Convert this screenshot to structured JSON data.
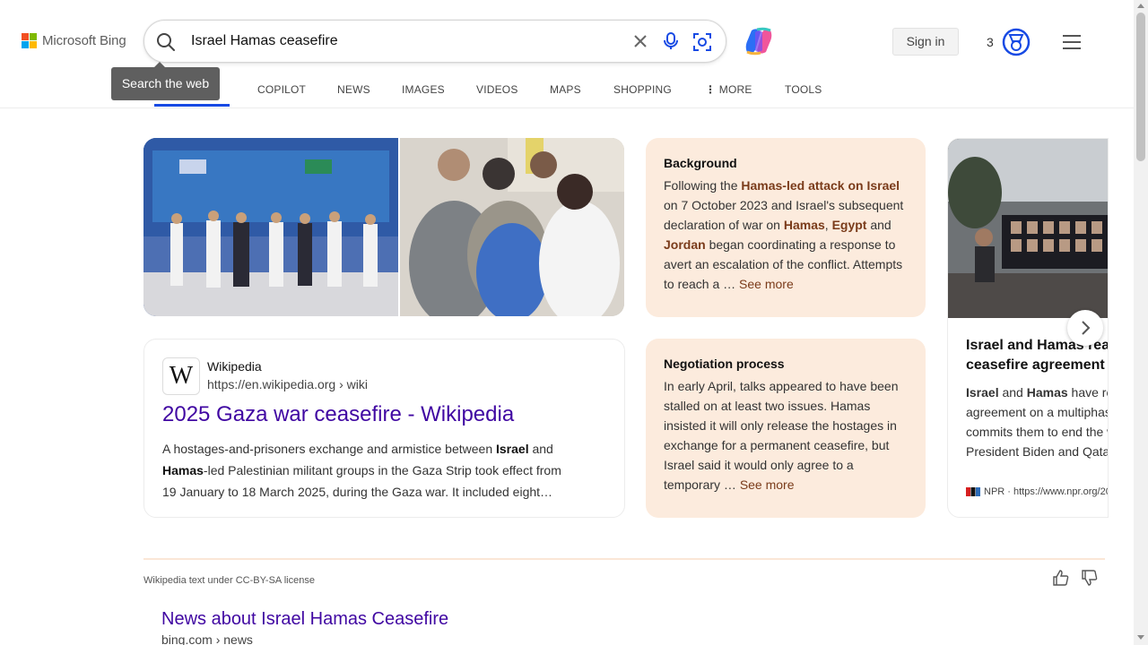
{
  "header": {
    "logo_text": "Microsoft Bing",
    "logo_colors": [
      "#f25022",
      "#7fba00",
      "#00a4ef",
      "#ffb900"
    ],
    "search_query": "Israel Hamas ceasefire",
    "tooltip": "Search the web",
    "signin_label": "Sign in",
    "rewards_count": "3",
    "accent_color": "#174ae4"
  },
  "tabs": [
    {
      "label": "SEARCH",
      "active": true
    },
    {
      "label": "COPILOT"
    },
    {
      "label": "NEWS"
    },
    {
      "label": "IMAGES"
    },
    {
      "label": "VIDEOS"
    },
    {
      "label": "MAPS"
    },
    {
      "label": "SHOPPING"
    },
    {
      "label": "MORE"
    },
    {
      "label": "TOOLS"
    }
  ],
  "tab_active_visible_text": "H",
  "wiki": {
    "source_name": "Wikipedia",
    "url": "https://en.wikipedia.org › wiki",
    "title": "2025 Gaza war ceasefire - Wikipedia",
    "snippet": {
      "p1": "A hostages-and-prisoners exchange and armistice between ",
      "b1": "Israel",
      "p2": " and ",
      "b2": "Hamas",
      "p3": "-led Palestinian militant groups in the Gaza Strip took effect from 19 January to 18 March 2025, during the Gaza war. It included eight…"
    }
  },
  "background_card": {
    "heading": "Background",
    "t1": "Following the ",
    "b1": "Hamas-led attack on Israel",
    "t2": " on 7 October 2023 and Israel's subsequent declaration of war on ",
    "b2": "Hamas",
    "t3": ", ",
    "b3": "Egypt",
    "t4": " and ",
    "b4": "Jordan",
    "t5": " began coordinating a response to avert an escalation of the conflict. Attempts to reach a … ",
    "see_more": "See more"
  },
  "negotiation_card": {
    "heading": "Negotiation process",
    "text": "In early April, talks appeared to have been stalled on at least two issues. Hamas insisted it will only release the hostages in exchange for a permanent ceasefire, but Israel said it would only agree to a temporary … ",
    "see_more": "See more"
  },
  "npr_card": {
    "title_line1": "Israel and Hamas rea",
    "title_line2": "ceasefire agreement",
    "b1": "Israel",
    "t1": " and ",
    "b2": "Hamas",
    "t2": " have re",
    "line2": "agreement on a multiphas",
    "line3": "commits them to end the w",
    "line4": "President Biden and Qata",
    "source": "NPR · https://www.npr.org/20"
  },
  "footer": {
    "license": "Wikipedia text under CC-BY-SA license",
    "news_title": "News about Israel Hamas Ceasefire",
    "news_url": "bing.com › news"
  }
}
